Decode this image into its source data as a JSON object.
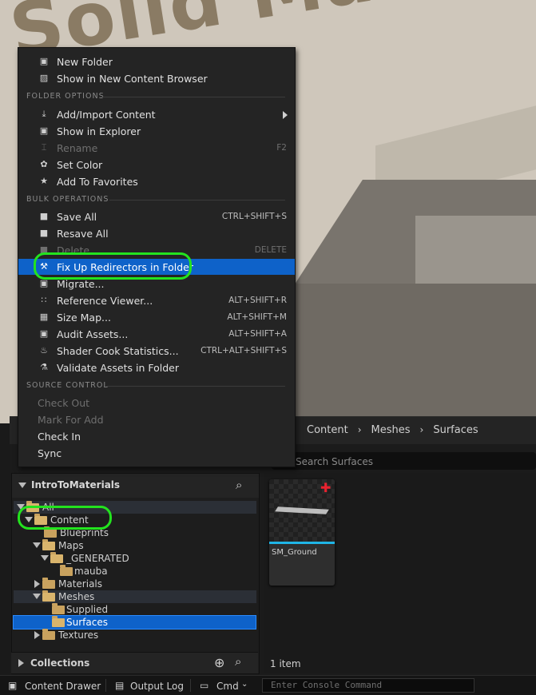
{
  "viewport": {
    "title_text": "Solid Mate"
  },
  "context_menu": {
    "items_top": [
      {
        "label": "New Folder",
        "icon": "new-folder-icon"
      },
      {
        "label": "Show in New Content Browser",
        "icon": "content-browser-icon"
      }
    ],
    "section_folder_options": "FOLDER OPTIONS",
    "folder_options": [
      {
        "label": "Add/Import Content",
        "icon": "import-icon",
        "submenu": true
      },
      {
        "label": "Show in Explorer",
        "icon": "explorer-icon"
      },
      {
        "label": "Rename",
        "icon": "rename-icon",
        "shortcut": "F2",
        "disabled": true
      },
      {
        "label": "Set Color",
        "icon": "color-icon"
      },
      {
        "label": "Add To Favorites",
        "icon": "star-icon"
      }
    ],
    "section_bulk_operations": "BULK OPERATIONS",
    "bulk_operations": [
      {
        "label": "Save All",
        "icon": "save-icon",
        "shortcut": "CTRL+SHIFT+S"
      },
      {
        "label": "Resave All",
        "icon": "save-icon"
      },
      {
        "label": "Delete",
        "icon": "delete-icon",
        "shortcut": "DELETE",
        "disabled": true
      },
      {
        "label": "Fix Up Redirectors in Folder",
        "icon": "wrench-icon",
        "highlighted": true
      },
      {
        "label": "Migrate...",
        "icon": "migrate-icon"
      },
      {
        "label": "Reference Viewer...",
        "icon": "reference-icon",
        "shortcut": "ALT+SHIFT+R"
      },
      {
        "label": "Size Map...",
        "icon": "size-map-icon",
        "shortcut": "ALT+SHIFT+M"
      },
      {
        "label": "Audit Assets...",
        "icon": "audit-icon",
        "shortcut": "ALT+SHIFT+A"
      },
      {
        "label": "Shader Cook Statistics...",
        "icon": "shader-icon",
        "shortcut": "CTRL+ALT+SHIFT+S"
      },
      {
        "label": "Validate Assets in Folder",
        "icon": "flask-icon"
      }
    ],
    "section_source_control": "SOURCE CONTROL",
    "source_control": [
      {
        "label": "Check Out",
        "disabled": true
      },
      {
        "label": "Mark For Add",
        "disabled": true
      },
      {
        "label": "Check In"
      },
      {
        "label": "Sync"
      }
    ]
  },
  "content_browser": {
    "breadcrumb": [
      "Content",
      "Meshes",
      "Surfaces"
    ],
    "search_placeholder": "Search Surfaces",
    "tree_title": "IntroToMaterials",
    "tree": [
      {
        "label": "All"
      },
      {
        "label": "Content"
      },
      {
        "label": "Blueprints"
      },
      {
        "label": "Maps"
      },
      {
        "label": "_GENERATED"
      },
      {
        "label": "mauba"
      },
      {
        "label": "Materials"
      },
      {
        "label": "Meshes"
      },
      {
        "label": "Supplied"
      },
      {
        "label": "Surfaces"
      },
      {
        "label": "Textures"
      }
    ],
    "collections_label": "Collections",
    "asset": {
      "name": "SM_Ground"
    },
    "item_count": "1 item"
  },
  "status_bar": {
    "content_drawer": "Content Drawer",
    "output_log": "Output Log",
    "cmd": "Cmd",
    "console_placeholder": "Enter Console Command"
  },
  "colors": {
    "highlight_ring": "#23e31e",
    "selection": "#0e62c9",
    "folder": "#c9a25e"
  }
}
